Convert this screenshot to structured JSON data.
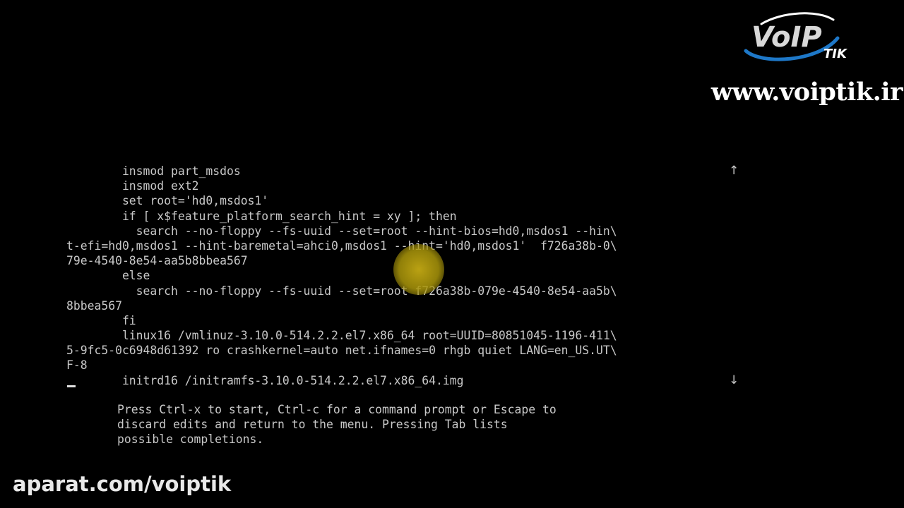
{
  "branding": {
    "logo_text": "VoIP",
    "logo_subtext": "TIK",
    "website": "www.voiptik.ir",
    "watermark": "aparat.com/voiptik"
  },
  "editor": {
    "lines": [
      "        insmod part_msdos",
      "        insmod ext2",
      "        set root='hd0,msdos1'",
      "        if [ x$feature_platform_search_hint = xy ]; then",
      "          search --no-floppy --fs-uuid --set=root --hint-bios=hd0,msdos1 --hin\\",
      "t-efi=hd0,msdos1 --hint-baremetal=ahci0,msdos1 --hint='hd0,msdos1'  f726a38b-0\\",
      "79e-4540-8e54-aa5b8bbea567",
      "        else",
      "          search --no-floppy --fs-uuid --set=root f726a38b-079e-4540-8e54-aa5b\\",
      "8bbea567",
      "        fi",
      "        linux16 /vmlinuz-3.10.0-514.2.2.el7.x86_64 root=UUID=80851045-1196-411\\",
      "5-9fc5-0c6948d61392 ro crashkernel=auto net.ifnames=0 rhgb quiet LANG=en_US.UT\\",
      "F-8",
      "        initrd16 /initramfs-3.10.0-514.2.2.el7.x86_64.img"
    ],
    "scroll_up_glyph": "↑",
    "scroll_down_glyph": "↓"
  },
  "help": {
    "lines": [
      "Press Ctrl-x to start, Ctrl-c for a command prompt or Escape to",
      "discard edits and return to the menu. Pressing Tab lists",
      "possible completions."
    ]
  },
  "colors": {
    "background": "#000000",
    "terminal_text": "#c8c8c8",
    "pointer_highlight": "#c4aa14",
    "logo_blue": "#1e78c8"
  }
}
